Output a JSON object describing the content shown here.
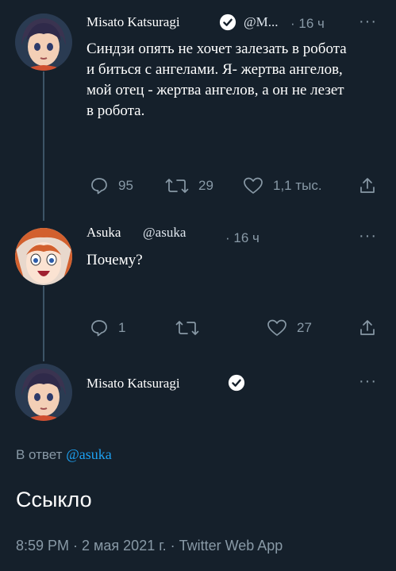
{
  "tweet1": {
    "author_name": "Misato Katsuragi",
    "handle": "@M...",
    "time": "· 16 ч",
    "more": "···",
    "text": "Синдзи опять не хочет залезать в робота и биться с ангелами. Я- жертва ангелов, мой отец - жертва ангелов, а он не лезет в робота.",
    "replies": "95",
    "retweets": "29",
    "likes": "1,1 тыс."
  },
  "tweet2": {
    "author_name": "Asuka",
    "handle": "@asuka",
    "time": "· 16 ч",
    "more": "···",
    "text": "Почему?",
    "replies": "1",
    "likes": "27"
  },
  "main_tweet": {
    "author_name": "Misato Katsuragi",
    "more": "···",
    "reply_prefix": "В ответ",
    "reply_handle": "@asuka",
    "text": "Ссыкло",
    "meta": "8:59 PM · 2 мая 2021 г. · Twitter Web App"
  },
  "colors": {
    "background": "#15202b",
    "secondary_text": "#8899a6",
    "link": "#1da1f2",
    "verified": "#ffffff"
  }
}
